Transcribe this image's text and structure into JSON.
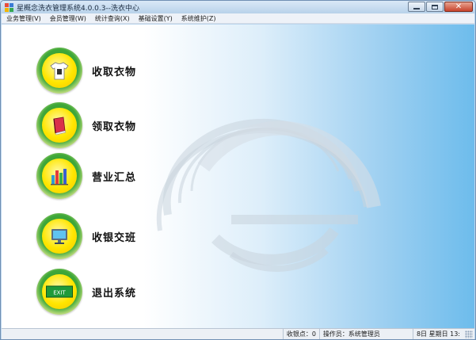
{
  "window": {
    "title": "星概念洗衣管理系统4.0.0.3--洗衣中心"
  },
  "menu": [
    {
      "label": "业务管理(V)"
    },
    {
      "label": "会员管理(W)"
    },
    {
      "label": "统计查询(X)"
    },
    {
      "label": "基础设置(Y)"
    },
    {
      "label": "系统维护(Z)"
    }
  ],
  "nav": [
    {
      "label": "收取衣物",
      "icon": "tshirt-icon"
    },
    {
      "label": "领取衣物",
      "icon": "book-icon"
    },
    {
      "label": "营业汇总",
      "icon": "bar-chart-icon"
    },
    {
      "label": "收银交班",
      "icon": "monitor-icon"
    },
    {
      "label": "退出系统",
      "icon": "exit-sign-icon",
      "sign_text": "EXIT"
    }
  ],
  "status": {
    "collection_point": "收银点：0",
    "operator": "操作员：系统管理员",
    "date": "8日 星期日 13:"
  },
  "colors": {
    "accent_green": "#3fa83a",
    "accent_yellow": "#ffe600",
    "background_blue": "#6dbcec"
  }
}
